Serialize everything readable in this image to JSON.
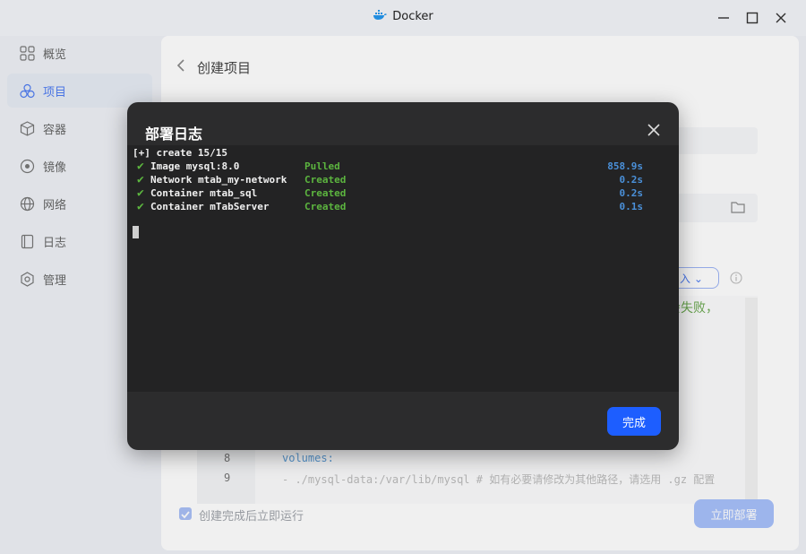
{
  "window": {
    "title": "Docker"
  },
  "sidebar": {
    "items": [
      {
        "label": "概览",
        "icon": "grid-icon",
        "active": false
      },
      {
        "label": "项目",
        "icon": "project-icon",
        "active": true
      },
      {
        "label": "容器",
        "icon": "container-icon",
        "active": false
      },
      {
        "label": "镜像",
        "icon": "image-icon",
        "active": false
      },
      {
        "label": "网络",
        "icon": "network-icon",
        "active": false
      },
      {
        "label": "日志",
        "icon": "log-icon",
        "active": false
      },
      {
        "label": "管理",
        "icon": "settings-icon",
        "active": false
      }
    ]
  },
  "main": {
    "title": "创建项目",
    "select_value": "入",
    "comment_tail": "会失败，",
    "editor_lines": [
      {
        "num": "8",
        "code": "volumes:"
      },
      {
        "num": "9",
        "code": "- ./mysql-data:/var/lib/mysql  # 如有必要请修改为其他路径，请选用 .gz 配置"
      }
    ],
    "run_after_create": "创建完成后立即运行",
    "deploy_button": "立即部署"
  },
  "modal": {
    "title": "部署日志",
    "log_header": "[+] create 15/15",
    "log_rows": [
      {
        "name": "Image mysql:8.0",
        "status": "Pulled",
        "time": "858.9s"
      },
      {
        "name": "Network mtab_my-network",
        "status": "Created",
        "time": "0.2s"
      },
      {
        "name": "Container mtab_sql",
        "status": "Created",
        "time": "0.2s"
      },
      {
        "name": "Container mTabServer",
        "status": "Created",
        "time": "0.1s"
      }
    ],
    "check_glyph": "✔",
    "done_button": "完成"
  },
  "colors": {
    "accent": "#1d5eff",
    "status_green": "#5cb53f",
    "time_blue": "#4a90d9",
    "modal_bg": "#2c2c2d"
  }
}
